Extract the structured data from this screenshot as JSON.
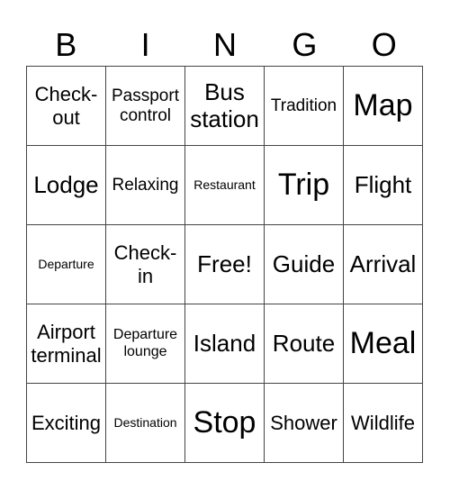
{
  "header": {
    "letters": [
      "B",
      "I",
      "N",
      "G",
      "O"
    ]
  },
  "card": {
    "cells": [
      {
        "text": "Check-\nout",
        "size": "s-lg"
      },
      {
        "text": "Passport control",
        "size": "s-md"
      },
      {
        "text": "Bus station",
        "size": "s-xl"
      },
      {
        "text": "Tradition",
        "size": "s-md"
      },
      {
        "text": "Map",
        "size": "s-xxl"
      },
      {
        "text": "Lodge",
        "size": "s-xl"
      },
      {
        "text": "Relaxing",
        "size": "s-md"
      },
      {
        "text": "Restaurant",
        "size": "s-xs"
      },
      {
        "text": "Trip",
        "size": "s-xxl"
      },
      {
        "text": "Flight",
        "size": "s-xl"
      },
      {
        "text": "Departure",
        "size": "s-xs"
      },
      {
        "text": "Check-\nin",
        "size": "s-lg"
      },
      {
        "text": "Free!",
        "size": "s-xl"
      },
      {
        "text": "Guide",
        "size": "s-xl"
      },
      {
        "text": "Arrival",
        "size": "s-xl"
      },
      {
        "text": "Airport terminal",
        "size": "s-lg"
      },
      {
        "text": "Departure lounge",
        "size": "s-sm"
      },
      {
        "text": "Island",
        "size": "s-xl"
      },
      {
        "text": "Route",
        "size": "s-xl"
      },
      {
        "text": "Meal",
        "size": "s-xxl"
      },
      {
        "text": "Exciting",
        "size": "s-lg"
      },
      {
        "text": "Destination",
        "size": "s-xs"
      },
      {
        "text": "Stop",
        "size": "s-xxl"
      },
      {
        "text": "Shower",
        "size": "s-lg"
      },
      {
        "text": "Wildlife",
        "size": "s-lg"
      }
    ]
  }
}
